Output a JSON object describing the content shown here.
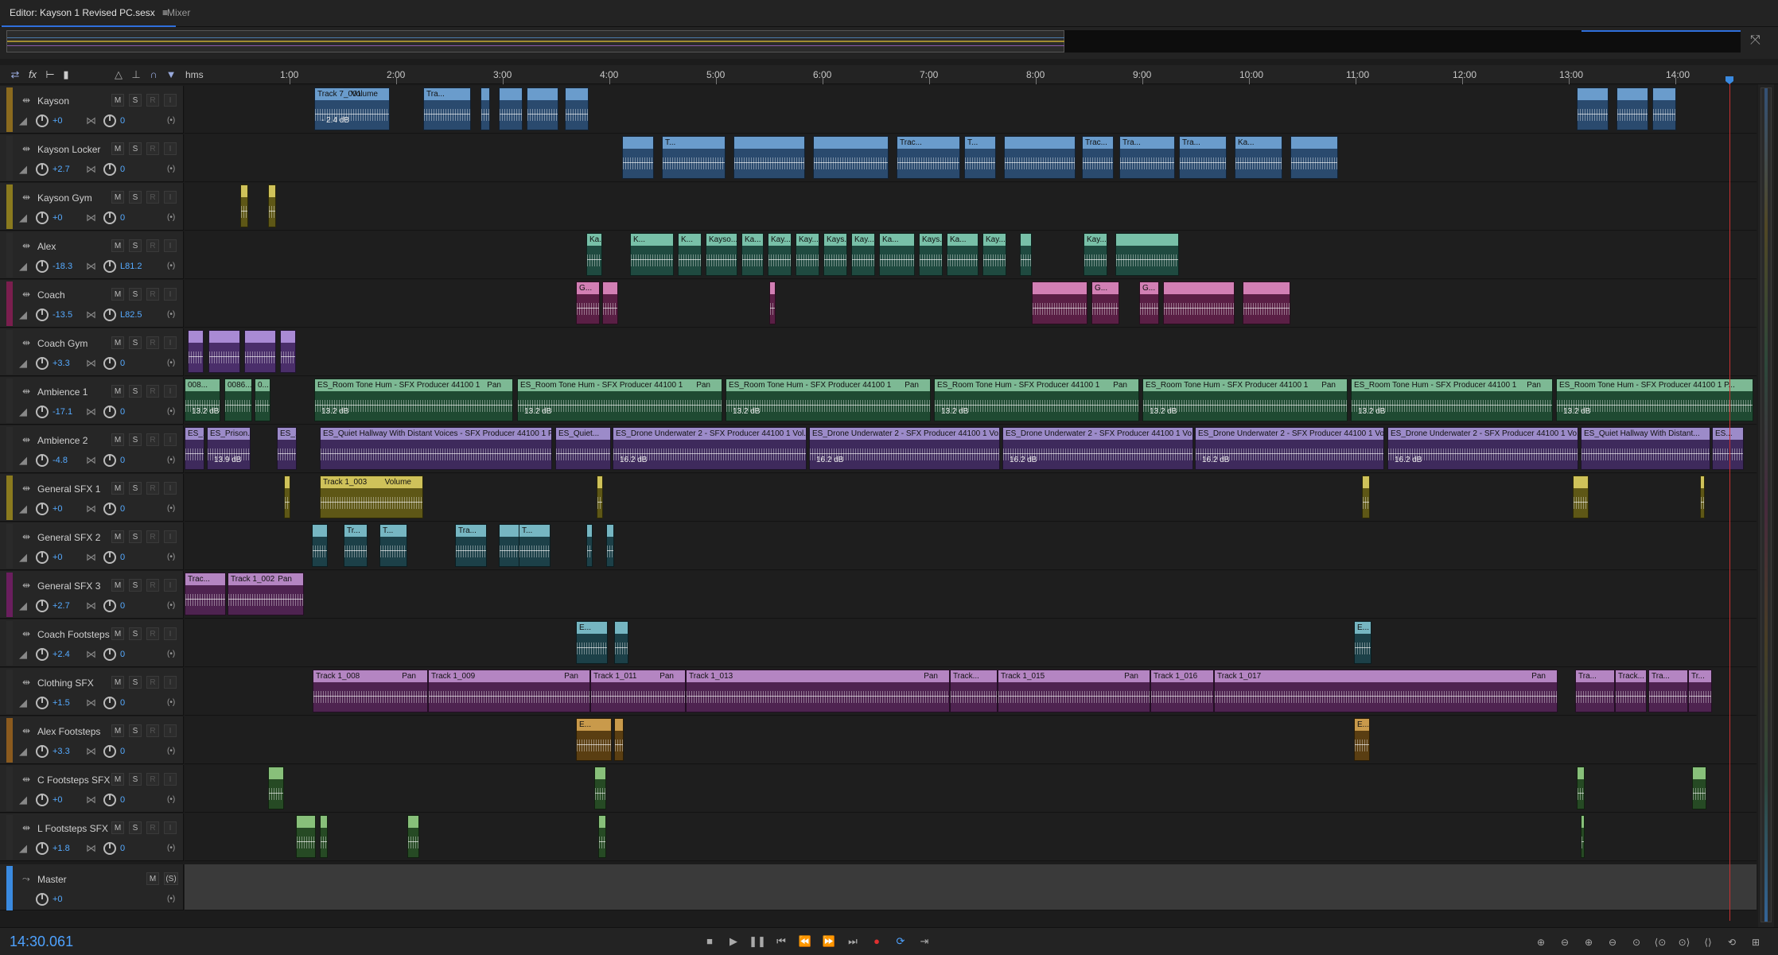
{
  "tabs": {
    "editor": "Editor: Kayson 1 Revised PC.sesx",
    "editor_menu": "≡",
    "mixer": "Mixer"
  },
  "ruler": {
    "unit": "hms",
    "labels": [
      "1:00",
      "2:00",
      "3:00",
      "4:00",
      "5:00",
      "6:00",
      "7:00",
      "8:00",
      "9:00",
      "10:00",
      "11:00",
      "12:00",
      "13:00",
      "14:00"
    ]
  },
  "track_buttons": {
    "mute": "M",
    "solo": "S",
    "record": "R",
    "input": "I"
  },
  "tracks": [
    {
      "name": "Kayson",
      "volume": "+0",
      "pan": "0",
      "color": "#8a6a1e"
    },
    {
      "name": "Kayson Locker",
      "volume": "+2.7",
      "pan": "0",
      "color": "#2a2a2a"
    },
    {
      "name": "Kayson Gym",
      "volume": "+0",
      "pan": "0",
      "color": "#8a7a1e"
    },
    {
      "name": "Alex",
      "volume": "-18.3",
      "pan": "L81.2",
      "color": "#2a2a2a"
    },
    {
      "name": "Coach",
      "volume": "-13.5",
      "pan": "L82.5",
      "color": "#7a1e4e"
    },
    {
      "name": "Coach Gym",
      "volume": "+3.3",
      "pan": "0",
      "color": "#2a2a2a"
    },
    {
      "name": "Ambience 1",
      "volume": "-17.1",
      "pan": "0",
      "color": "#2a2a2a"
    },
    {
      "name": "Ambience 2",
      "volume": "-4.8",
      "pan": "0",
      "color": "#2a2a2a"
    },
    {
      "name": "General SFX 1",
      "volume": "+0",
      "pan": "0",
      "color": "#8a7a1e"
    },
    {
      "name": "General SFX 2",
      "volume": "+0",
      "pan": "0",
      "color": "#2a2a2a"
    },
    {
      "name": "General SFX 3",
      "volume": "+2.7",
      "pan": "0",
      "color": "#6a1e5e"
    },
    {
      "name": "Coach Footsteps",
      "volume": "+2.4",
      "pan": "0",
      "color": "#2a2a2a"
    },
    {
      "name": "Clothing SFX",
      "volume": "+1.5",
      "pan": "0",
      "color": "#2a2a2a"
    },
    {
      "name": "Alex Footsteps",
      "volume": "+3.3",
      "pan": "0",
      "color": "#8a5a1e"
    },
    {
      "name": "C Footsteps SFX",
      "volume": "+0",
      "pan": "0",
      "color": "#2a2a2a"
    },
    {
      "name": "L Footsteps SFX",
      "volume": "+1.8",
      "pan": "0",
      "color": "#2a2a2a"
    }
  ],
  "master": {
    "name": "Master",
    "volume": "+0",
    "mute": "M",
    "solo": "(S)"
  },
  "clips": {
    "kayson_1": "Track 7_001",
    "kayson_1_param": "Volume",
    "kayson_1_gain": "- 2.4 dB",
    "kayson_2": "Tra...",
    "locker_1": "T...",
    "locker_2": "Trac...",
    "locker_3": "T...",
    "locker_4": "Trac...",
    "locker_5": "Tra...",
    "locker_6": "Tra...",
    "locker_7": "Ka...",
    "alex_labels": [
      "Ka...",
      "K...",
      "K...",
      "Kayso...",
      "Ka...",
      "Kay...",
      "Kay...",
      "Kays...",
      "Kay...",
      "Ka...",
      "Kays...",
      "Ka...",
      "Kay...",
      "Kay..."
    ],
    "coach_1": "G...",
    "coach_2": "G...",
    "coach_3": "G...",
    "amb1_small_1": "008...",
    "amb1_small_2": "0086...",
    "amb1_small_3": "0...",
    "amb1_name": "ES_Room Tone Hum - SFX Producer 44100 1",
    "amb1_name_last": "ES_Room Tone Hum - SFX Producer 44100 1 P...",
    "amb1_pan": "Pan",
    "amb1_gain": "13.2 dB",
    "amb2_small_1": "ES_...",
    "amb2_small_2": "ES_Prison...",
    "amb2_small_3": "ES_...",
    "amb2_quiet": "ES_Quiet Hallway With Distant Voices - SFX Producer 44100 1 P...",
    "amb2_quiet_short": "ES_Quiet...",
    "amb2_drone_a": "ES_Drone Underwater 2 - SFX Producer 44100 1 Vol...",
    "amb2_drone_b": "ES_Drone Underwater 2 - SFX Producer 44100 1 Vo...",
    "amb2_quiet_end": "ES_Quiet Hallway With Distant...",
    "amb2_end": "ES...",
    "amb2_gain_small": "13.9 dB",
    "amb2_gain": "16.2 dB",
    "sfx1_clip": "Track 1_003",
    "sfx1_param": "Volume",
    "sfx2_1": "Tr...",
    "sfx2_2": "T...",
    "sfx2_3": "Tra...",
    "sfx2_4": "T...",
    "sfx3_1": "Trac...",
    "sfx3_2": "Track 1_002",
    "sfx3_param": "Pan",
    "cf_1": "E...",
    "cf_2": "E...",
    "cloth_1": "Track 1_008",
    "cloth_2": "Track 1_009",
    "cloth_3": "Track 1_011",
    "cloth_4": "Track 1_013",
    "cloth_5": "Track...",
    "cloth_6": "Track 1_015",
    "cloth_7": "Track 1_016",
    "cloth_8": "Track 1_017",
    "cloth_9": "Tra...",
    "cloth_10": "Track...",
    "cloth_11": "Tra...",
    "cloth_12": "Tr...",
    "cloth_param": "Pan",
    "af_1": "E...",
    "af_2": "E..."
  },
  "timecode": "14:30.061",
  "colors": {
    "accent": "#2f6fdc",
    "timecode": "#4ea2ff",
    "playhead": "#c83030"
  }
}
